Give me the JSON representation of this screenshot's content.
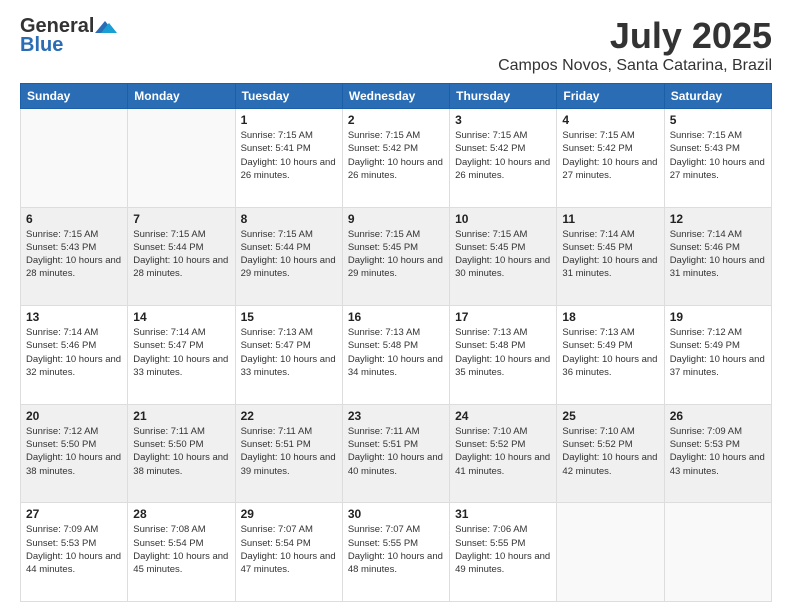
{
  "header": {
    "logo_general": "General",
    "logo_blue": "Blue",
    "main_title": "July 2025",
    "subtitle": "Campos Novos, Santa Catarina, Brazil"
  },
  "days_of_week": [
    "Sunday",
    "Monday",
    "Tuesday",
    "Wednesday",
    "Thursday",
    "Friday",
    "Saturday"
  ],
  "weeks": [
    [
      {
        "day": "",
        "info": ""
      },
      {
        "day": "",
        "info": ""
      },
      {
        "day": "1",
        "info": "Sunrise: 7:15 AM\nSunset: 5:41 PM\nDaylight: 10 hours and 26 minutes."
      },
      {
        "day": "2",
        "info": "Sunrise: 7:15 AM\nSunset: 5:42 PM\nDaylight: 10 hours and 26 minutes."
      },
      {
        "day": "3",
        "info": "Sunrise: 7:15 AM\nSunset: 5:42 PM\nDaylight: 10 hours and 26 minutes."
      },
      {
        "day": "4",
        "info": "Sunrise: 7:15 AM\nSunset: 5:42 PM\nDaylight: 10 hours and 27 minutes."
      },
      {
        "day": "5",
        "info": "Sunrise: 7:15 AM\nSunset: 5:43 PM\nDaylight: 10 hours and 27 minutes."
      }
    ],
    [
      {
        "day": "6",
        "info": "Sunrise: 7:15 AM\nSunset: 5:43 PM\nDaylight: 10 hours and 28 minutes."
      },
      {
        "day": "7",
        "info": "Sunrise: 7:15 AM\nSunset: 5:44 PM\nDaylight: 10 hours and 28 minutes."
      },
      {
        "day": "8",
        "info": "Sunrise: 7:15 AM\nSunset: 5:44 PM\nDaylight: 10 hours and 29 minutes."
      },
      {
        "day": "9",
        "info": "Sunrise: 7:15 AM\nSunset: 5:45 PM\nDaylight: 10 hours and 29 minutes."
      },
      {
        "day": "10",
        "info": "Sunrise: 7:15 AM\nSunset: 5:45 PM\nDaylight: 10 hours and 30 minutes."
      },
      {
        "day": "11",
        "info": "Sunrise: 7:14 AM\nSunset: 5:45 PM\nDaylight: 10 hours and 31 minutes."
      },
      {
        "day": "12",
        "info": "Sunrise: 7:14 AM\nSunset: 5:46 PM\nDaylight: 10 hours and 31 minutes."
      }
    ],
    [
      {
        "day": "13",
        "info": "Sunrise: 7:14 AM\nSunset: 5:46 PM\nDaylight: 10 hours and 32 minutes."
      },
      {
        "day": "14",
        "info": "Sunrise: 7:14 AM\nSunset: 5:47 PM\nDaylight: 10 hours and 33 minutes."
      },
      {
        "day": "15",
        "info": "Sunrise: 7:13 AM\nSunset: 5:47 PM\nDaylight: 10 hours and 33 minutes."
      },
      {
        "day": "16",
        "info": "Sunrise: 7:13 AM\nSunset: 5:48 PM\nDaylight: 10 hours and 34 minutes."
      },
      {
        "day": "17",
        "info": "Sunrise: 7:13 AM\nSunset: 5:48 PM\nDaylight: 10 hours and 35 minutes."
      },
      {
        "day": "18",
        "info": "Sunrise: 7:13 AM\nSunset: 5:49 PM\nDaylight: 10 hours and 36 minutes."
      },
      {
        "day": "19",
        "info": "Sunrise: 7:12 AM\nSunset: 5:49 PM\nDaylight: 10 hours and 37 minutes."
      }
    ],
    [
      {
        "day": "20",
        "info": "Sunrise: 7:12 AM\nSunset: 5:50 PM\nDaylight: 10 hours and 38 minutes."
      },
      {
        "day": "21",
        "info": "Sunrise: 7:11 AM\nSunset: 5:50 PM\nDaylight: 10 hours and 38 minutes."
      },
      {
        "day": "22",
        "info": "Sunrise: 7:11 AM\nSunset: 5:51 PM\nDaylight: 10 hours and 39 minutes."
      },
      {
        "day": "23",
        "info": "Sunrise: 7:11 AM\nSunset: 5:51 PM\nDaylight: 10 hours and 40 minutes."
      },
      {
        "day": "24",
        "info": "Sunrise: 7:10 AM\nSunset: 5:52 PM\nDaylight: 10 hours and 41 minutes."
      },
      {
        "day": "25",
        "info": "Sunrise: 7:10 AM\nSunset: 5:52 PM\nDaylight: 10 hours and 42 minutes."
      },
      {
        "day": "26",
        "info": "Sunrise: 7:09 AM\nSunset: 5:53 PM\nDaylight: 10 hours and 43 minutes."
      }
    ],
    [
      {
        "day": "27",
        "info": "Sunrise: 7:09 AM\nSunset: 5:53 PM\nDaylight: 10 hours and 44 minutes."
      },
      {
        "day": "28",
        "info": "Sunrise: 7:08 AM\nSunset: 5:54 PM\nDaylight: 10 hours and 45 minutes."
      },
      {
        "day": "29",
        "info": "Sunrise: 7:07 AM\nSunset: 5:54 PM\nDaylight: 10 hours and 47 minutes."
      },
      {
        "day": "30",
        "info": "Sunrise: 7:07 AM\nSunset: 5:55 PM\nDaylight: 10 hours and 48 minutes."
      },
      {
        "day": "31",
        "info": "Sunrise: 7:06 AM\nSunset: 5:55 PM\nDaylight: 10 hours and 49 minutes."
      },
      {
        "day": "",
        "info": ""
      },
      {
        "day": "",
        "info": ""
      }
    ]
  ]
}
